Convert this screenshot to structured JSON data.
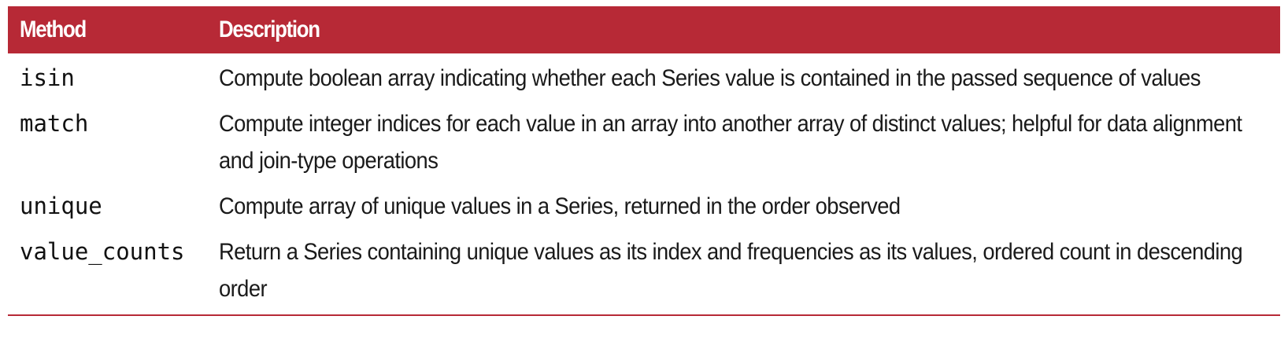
{
  "table": {
    "header": {
      "method": "Method",
      "description": "Description"
    },
    "rows": [
      {
        "method": "isin",
        "description": "Compute boolean array indicating whether each Series value is contained in the passed sequence of values"
      },
      {
        "method": "match",
        "description": "Compute integer indices for each value in an array into another array of distinct values; helpful for data alignment and join-type operations"
      },
      {
        "method": "unique",
        "description": "Compute array of unique values in a Series, returned in the order observed"
      },
      {
        "method": "value_counts",
        "description": "Return a Series containing unique values as its index and frequencies as its values, ordered count in descending order"
      }
    ]
  },
  "colors": {
    "header_bg": "#b72936",
    "header_text": "#ffffff",
    "body_text": "#1a1a1a"
  }
}
